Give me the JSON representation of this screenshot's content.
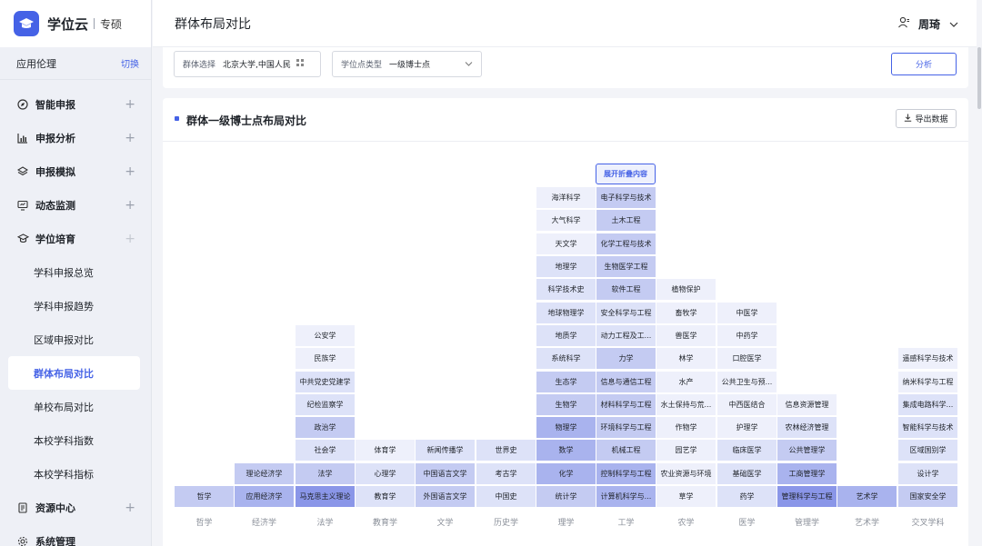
{
  "app": {
    "name": "学位云",
    "edition": "专硕"
  },
  "context": {
    "label": "应用伦理",
    "switch": "切换"
  },
  "menu": [
    {
      "label": "智能申报",
      "icon": "compass-icon"
    },
    {
      "label": "申报分析",
      "icon": "bar-chart-icon"
    },
    {
      "label": "申报模拟",
      "icon": "layers-icon"
    },
    {
      "label": "动态监测",
      "icon": "monitor-icon"
    },
    {
      "label": "学位培育",
      "icon": "graduation-cap-icon"
    }
  ],
  "submenu": [
    "学科申报总览",
    "学科申报趋势",
    "区域申报对比",
    "群体布局对比",
    "单校布局对比",
    "本校学科指数",
    "本校学科指标"
  ],
  "menu_bottom": [
    {
      "label": "资源中心",
      "icon": "document-icon"
    },
    {
      "label": "系统管理",
      "icon": "gear-icon"
    }
  ],
  "page": {
    "title": "群体布局对比"
  },
  "user": {
    "name": "周琦"
  },
  "filter": {
    "group_label": "群体选择",
    "group_value": "北京大学,中国人民",
    "type_label": "学位点类型",
    "type_value": "一级博士点",
    "analyze": "分析"
  },
  "card": {
    "title": "群体一级博士点布局对比",
    "export": "导出数据",
    "expand": "展开折叠内容"
  },
  "colors": {
    "accent": "#4562e6",
    "level0": "#eef0fb",
    "level1": "#dde2f8",
    "level2": "#c4cbf2",
    "level3": "#a9b3ee",
    "level4": "#8a96e8"
  },
  "chart_data": {
    "type": "table",
    "columns": [
      {
        "category": "哲学",
        "items": [
          {
            "name": "哲学",
            "level": 2
          }
        ]
      },
      {
        "category": "经济学",
        "items": [
          {
            "name": "应用经济学",
            "level": 3
          },
          {
            "name": "理论经济学",
            "level": 2
          }
        ]
      },
      {
        "category": "法学",
        "items": [
          {
            "name": "马克思主义理论",
            "level": 4
          },
          {
            "name": "法学",
            "level": 2
          },
          {
            "name": "社会学",
            "level": 1
          },
          {
            "name": "政治学",
            "level": 2
          },
          {
            "name": "纪检监察学",
            "level": 1
          },
          {
            "name": "中共党史党建学",
            "level": 1
          },
          {
            "name": "民族学",
            "level": 0
          },
          {
            "name": "公安学",
            "level": 0
          }
        ]
      },
      {
        "category": "教育学",
        "items": [
          {
            "name": "教育学",
            "level": 1
          },
          {
            "name": "心理学",
            "level": 1
          },
          {
            "name": "体育学",
            "level": 0
          }
        ]
      },
      {
        "category": "文学",
        "items": [
          {
            "name": "外国语言文学",
            "level": 2
          },
          {
            "name": "中国语言文学",
            "level": 2
          },
          {
            "name": "新闻传播学",
            "level": 1
          }
        ]
      },
      {
        "category": "历史学",
        "items": [
          {
            "name": "中国史",
            "level": 1
          },
          {
            "name": "考古学",
            "level": 1
          },
          {
            "name": "世界史",
            "level": 1
          }
        ]
      },
      {
        "category": "理学",
        "items": [
          {
            "name": "统计学",
            "level": 2
          },
          {
            "name": "化学",
            "level": 3
          },
          {
            "name": "数学",
            "level": 3
          },
          {
            "name": "物理学",
            "level": 3
          },
          {
            "name": "生物学",
            "level": 2
          },
          {
            "name": "生态学",
            "level": 2
          },
          {
            "name": "系统科学",
            "level": 1
          },
          {
            "name": "地质学",
            "level": 1
          },
          {
            "name": "地球物理学",
            "level": 1
          },
          {
            "name": "科学技术史",
            "level": 1
          },
          {
            "name": "地理学",
            "level": 1
          },
          {
            "name": "天文学",
            "level": 0
          },
          {
            "name": "大气科学",
            "level": 0
          },
          {
            "name": "海洋科学",
            "level": 0
          }
        ]
      },
      {
        "category": "工学",
        "items": [
          {
            "name": "计算机科学与...",
            "level": 3
          },
          {
            "name": "控制科学与工程",
            "level": 3
          },
          {
            "name": "机械工程",
            "level": 2
          },
          {
            "name": "环境科学与工程",
            "level": 2
          },
          {
            "name": "材料科学与工程",
            "level": 2
          },
          {
            "name": "信息与通信工程",
            "level": 2
          },
          {
            "name": "力学",
            "level": 2
          },
          {
            "name": "动力工程及工...",
            "level": 1
          },
          {
            "name": "安全科学与工程",
            "level": 1
          },
          {
            "name": "软件工程",
            "level": 2
          },
          {
            "name": "生物医学工程",
            "level": 2
          },
          {
            "name": "化学工程与技术",
            "level": 2
          },
          {
            "name": "土木工程",
            "level": 2
          },
          {
            "name": "电子科学与技术",
            "level": 2
          }
        ]
      },
      {
        "category": "农学",
        "items": [
          {
            "name": "草学",
            "level": 0
          },
          {
            "name": "农业资源与环境",
            "level": 0
          },
          {
            "name": "园艺学",
            "level": 0
          },
          {
            "name": "作物学",
            "level": 0
          },
          {
            "name": "水土保持与荒...",
            "level": 0
          },
          {
            "name": "水产",
            "level": 0
          },
          {
            "name": "林学",
            "level": 0
          },
          {
            "name": "兽医学",
            "level": 0
          },
          {
            "name": "畜牧学",
            "level": 0
          },
          {
            "name": "植物保护",
            "level": 0
          }
        ]
      },
      {
        "category": "医学",
        "items": [
          {
            "name": "药学",
            "level": 1
          },
          {
            "name": "基础医学",
            "level": 1
          },
          {
            "name": "临床医学",
            "level": 1
          },
          {
            "name": "护理学",
            "level": 0
          },
          {
            "name": "中西医结合",
            "level": 0
          },
          {
            "name": "公共卫生与预...",
            "level": 0
          },
          {
            "name": "口腔医学",
            "level": 0
          },
          {
            "name": "中药学",
            "level": 0
          },
          {
            "name": "中医学",
            "level": 0
          }
        ]
      },
      {
        "category": "管理学",
        "items": [
          {
            "name": "管理科学与工程",
            "level": 4
          },
          {
            "name": "工商管理学",
            "level": 3
          },
          {
            "name": "公共管理学",
            "level": 2
          },
          {
            "name": "农林经济管理",
            "level": 1
          },
          {
            "name": "信息资源管理",
            "level": 0
          }
        ]
      },
      {
        "category": "艺术学",
        "items": [
          {
            "name": "艺术学",
            "level": 3
          }
        ]
      },
      {
        "category": "交叉学科",
        "items": [
          {
            "name": "国家安全学",
            "level": 2
          },
          {
            "name": "设计学",
            "level": 1
          },
          {
            "name": "区域国别学",
            "level": 1
          },
          {
            "name": "智能科学与技术",
            "level": 1
          },
          {
            "name": "集成电路科学...",
            "level": 1
          },
          {
            "name": "纳米科学与工程",
            "level": 0
          },
          {
            "name": "遥感科学与技术",
            "level": 0
          }
        ]
      }
    ]
  }
}
